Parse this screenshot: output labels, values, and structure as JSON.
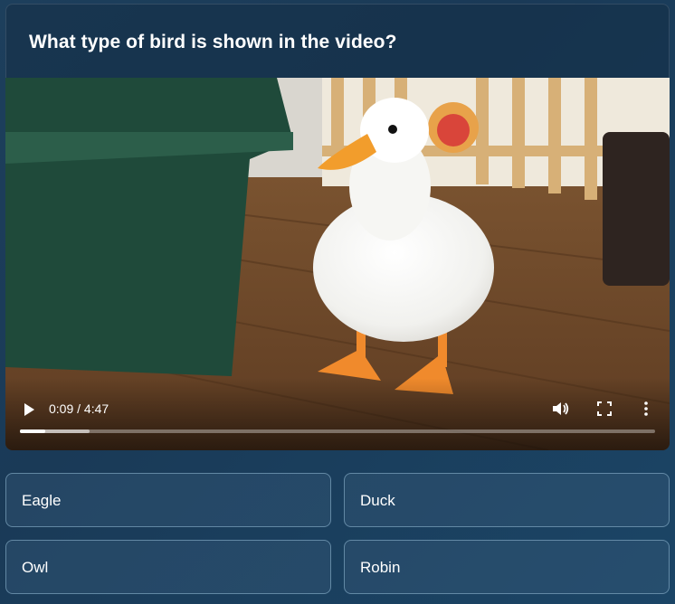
{
  "question": {
    "text": "What type of bird is shown in the video?"
  },
  "video": {
    "time_display": "0:09 / 4:47",
    "current_time": "0:09",
    "duration": "4:47",
    "played_fraction": 0.04,
    "buffered_fraction": 0.11,
    "state": "paused",
    "icons": {
      "play": "play-icon",
      "volume": "volume-icon",
      "fullscreen": "fullscreen-icon",
      "more": "more-options-icon"
    }
  },
  "answers": [
    {
      "label": "Eagle"
    },
    {
      "label": "Duck"
    },
    {
      "label": "Owl"
    },
    {
      "label": "Robin"
    }
  ],
  "colors": {
    "background": "#1a3a57",
    "answer_border": "#96bed7",
    "text": "#ffffff"
  }
}
